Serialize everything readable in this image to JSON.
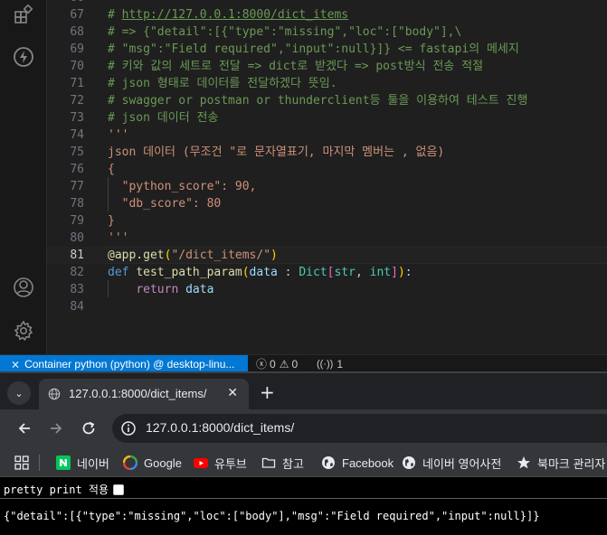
{
  "editor": {
    "lines": [
      {
        "n": "66",
        "segments": []
      },
      {
        "n": "67",
        "segments": [
          {
            "t": "# ",
            "c": "c-green"
          },
          {
            "t": "http://127.0.0.1:8000/dict_items",
            "c": "c-link"
          }
        ]
      },
      {
        "n": "68",
        "segments": [
          {
            "t": "# => {\"detail\":[{\"type\":\"missing\",\"loc\":[\"body\"],\\",
            "c": "c-green"
          }
        ]
      },
      {
        "n": "69",
        "segments": [
          {
            "t": "# \"msg\":\"Field required\",\"input\":null}]} <= fastapi의 메세지",
            "c": "c-green"
          }
        ]
      },
      {
        "n": "70",
        "segments": [
          {
            "t": "# 키와 값의 세트로 전달 => dict로 받겠다 => post방식 전송 적절",
            "c": "c-green"
          }
        ]
      },
      {
        "n": "71",
        "segments": [
          {
            "t": "# json 형태로 데이터를 전달하겠다 뜻임.",
            "c": "c-green"
          }
        ]
      },
      {
        "n": "72",
        "segments": [
          {
            "t": "# swagger or postman or thunderclient등 툴을 이용하여 테스트 진행",
            "c": "c-green"
          }
        ]
      },
      {
        "n": "73",
        "segments": [
          {
            "t": "# json 데이터 전송",
            "c": "c-green"
          }
        ]
      },
      {
        "n": "74",
        "segments": [
          {
            "t": "'''",
            "c": "c-orange"
          }
        ]
      },
      {
        "n": "75",
        "segments": [
          {
            "t": "json 데이터 (무조건 \"로 문자열표기, 마지막 멤버는 , 없음)",
            "c": "c-orange"
          }
        ]
      },
      {
        "n": "76",
        "segments": [
          {
            "t": "{",
            "c": "c-orange"
          }
        ]
      },
      {
        "n": "77",
        "segments": [
          {
            "t": "  \"python_score\": 90,",
            "c": "c-orange"
          }
        ]
      },
      {
        "n": "78",
        "segments": [
          {
            "t": "  \"db_score\": 80",
            "c": "c-orange"
          }
        ]
      },
      {
        "n": "79",
        "segments": [
          {
            "t": "}",
            "c": "c-orange"
          }
        ]
      },
      {
        "n": "80",
        "segments": [
          {
            "t": "'''",
            "c": "c-orange"
          }
        ]
      },
      {
        "n": "81",
        "current": true,
        "segments": [
          {
            "t": "@app.get",
            "c": "c-yellow"
          },
          {
            "t": "(",
            "c": "c-bracket1"
          },
          {
            "t": "\"/dict_items/\"",
            "c": "c-orange"
          },
          {
            "t": ")",
            "c": "c-bracket1"
          }
        ]
      },
      {
        "n": "82",
        "segments": [
          {
            "t": "def ",
            "c": "c-blue"
          },
          {
            "t": "test_path_param",
            "c": "c-yellow"
          },
          {
            "t": "(",
            "c": "c-bracket1"
          },
          {
            "t": "data",
            "c": "c-lightblue"
          },
          {
            "t": " : ",
            "c": ""
          },
          {
            "t": "Dict",
            "c": "c-teal"
          },
          {
            "t": "[",
            "c": "c-bracket2"
          },
          {
            "t": "str",
            "c": "c-teal"
          },
          {
            "t": ", ",
            "c": ""
          },
          {
            "t": "int",
            "c": "c-teal"
          },
          {
            "t": "]",
            "c": "c-bracket2"
          },
          {
            "t": ")",
            "c": "c-bracket1"
          },
          {
            "t": ":",
            "c": ""
          }
        ]
      },
      {
        "n": "83",
        "segments": [
          {
            "t": "    ",
            "c": ""
          },
          {
            "t": "return",
            "c": "c-purple"
          },
          {
            "t": " data",
            "c": "c-lightblue"
          }
        ]
      },
      {
        "n": "84",
        "segments": []
      }
    ]
  },
  "statusbar": {
    "remote_label": "Container python (python) @ desktop-linu...",
    "errors": "0",
    "warnings": "0",
    "ports": "1"
  },
  "browser": {
    "tab_title": "127.0.0.1:8000/dict_items/",
    "address": "127.0.0.1:8000/dict_items/",
    "bookmarks": [
      {
        "label": "네이버",
        "icon": "naver-icon"
      },
      {
        "label": "Google",
        "icon": "google-icon"
      },
      {
        "label": "유투브",
        "icon": "youtube-icon"
      },
      {
        "label": "참고",
        "icon": "folder-icon"
      },
      {
        "label": "Facebook",
        "icon": "globe-icon"
      },
      {
        "label": "네이버 영어사전",
        "icon": "globe-icon"
      },
      {
        "label": "북마크 관리자",
        "icon": "star-icon"
      }
    ],
    "pretty_print_label": "pretty print 적용",
    "response_json": "{\"detail\":[{\"type\":\"missing\",\"loc\":[\"body\"],\"msg\":\"Field required\",\"input\":null}]}"
  },
  "colors": {
    "accent": "#0078d4",
    "editor_bg": "#1f1f1f",
    "comment": "#6a9955",
    "string": "#ce9178"
  }
}
